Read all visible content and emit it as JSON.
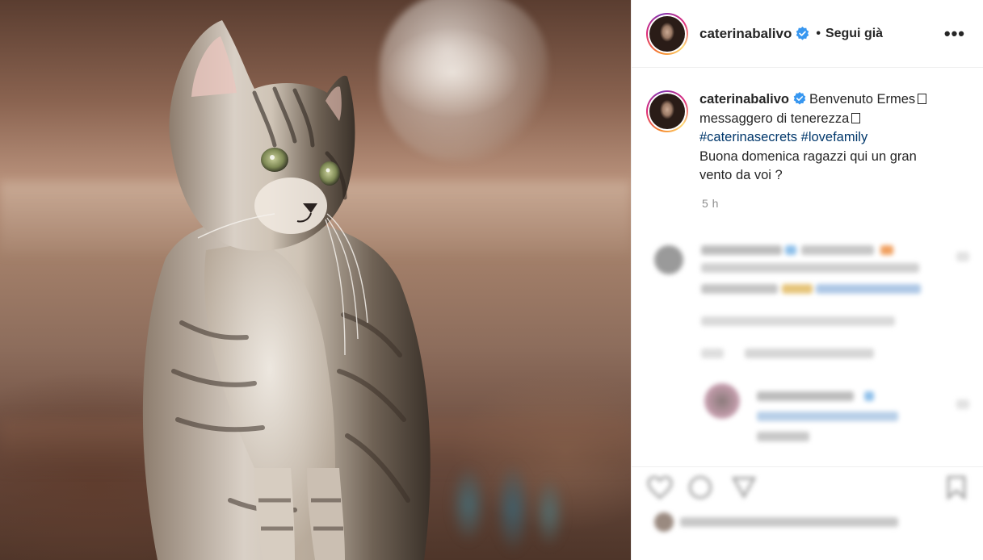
{
  "post": {
    "username": "caterinabalivo",
    "separator": "•",
    "follow_label": "Segui già",
    "more_label": "•••",
    "caption": {
      "username": "caterinabalivo",
      "line1": "Benvenuto Ermes",
      "line2": "messaggero di tenerezza",
      "hashtag1": "#caterinasecrets",
      "hashtag2": "#lovefamily",
      "line4": "Buona domenica ragazzi qui un gran",
      "line5": "vento da voi ?"
    },
    "timestamp": "5 h"
  },
  "colors": {
    "verified": "#3897f0",
    "hashtag": "#00376b",
    "text": "#262626",
    "muted": "#8e8e8e"
  },
  "icons": [
    "verified-badge-icon",
    "more-options-icon",
    "like-icon",
    "comment-icon",
    "share-icon",
    "save-icon"
  ]
}
